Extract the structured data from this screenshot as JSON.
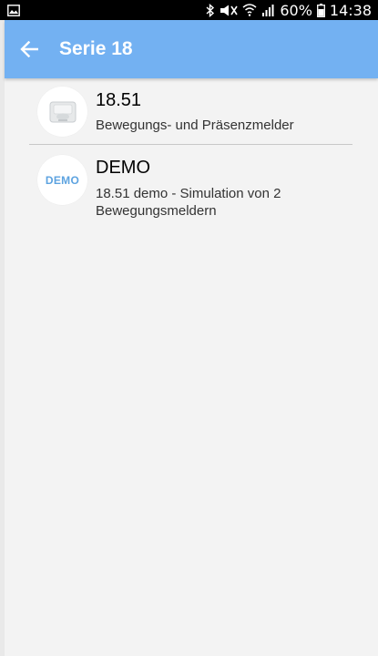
{
  "status_bar": {
    "battery": "60%",
    "time": "14:38",
    "icons": [
      "gallery-icon",
      "bluetooth-icon",
      "mute-icon",
      "wifi-icon",
      "signal-icon",
      "battery-icon"
    ]
  },
  "app_bar": {
    "title": "Serie 18",
    "back_icon": "arrow-left-icon",
    "color": "#73b1f2"
  },
  "list": {
    "items": [
      {
        "title": "18.51",
        "subtitle": "Bewegungs- und Präsenzmelder",
        "icon": "motion-sensor-icon"
      },
      {
        "title": "DEMO",
        "subtitle": "18.51 demo - Simulation von 2 Bewegungsmeldern",
        "badge": "DEMO"
      }
    ]
  }
}
